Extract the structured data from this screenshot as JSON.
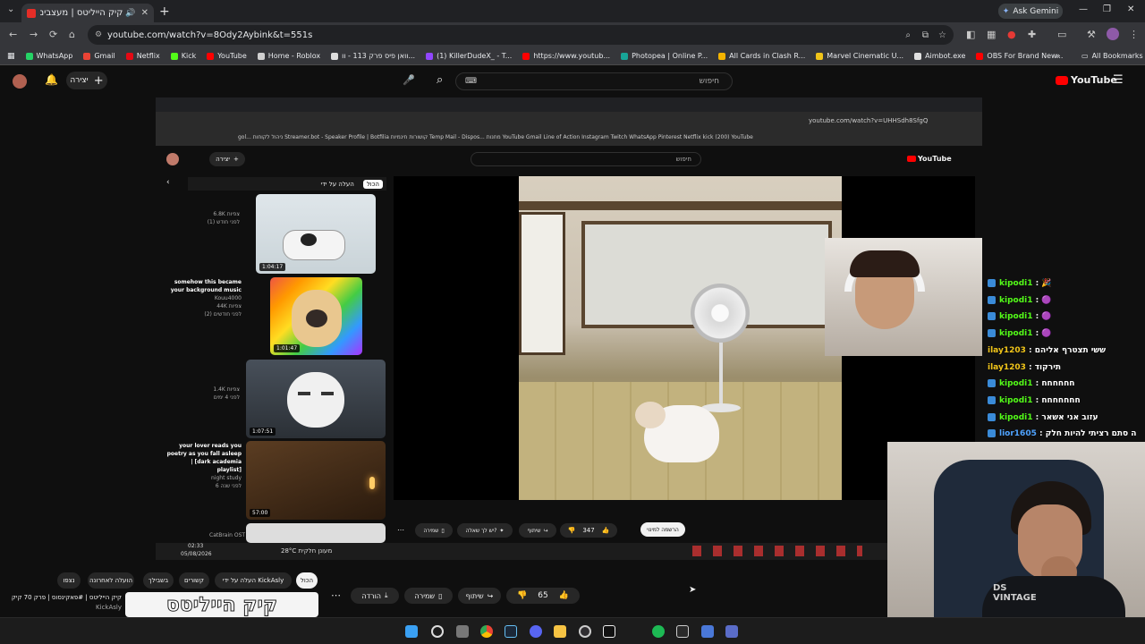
{
  "browser": {
    "tab_title": "קיק הייליטס | מעצבים איט",
    "omnibox_url": "youtube.com/watch?v=8Ody2Aybink&t=551s",
    "ask_gemini": "Ask Gemini",
    "all_bookmarks": "All Bookmarks",
    "bookmarks": [
      {
        "label": "WhatsApp",
        "color": "#25d366"
      },
      {
        "label": "Gmail",
        "color": "#ea4335"
      },
      {
        "label": "Netflix",
        "color": "#e50914"
      },
      {
        "label": "Kick",
        "color": "#53fc18"
      },
      {
        "label": "YouTube",
        "color": "#ff0000"
      },
      {
        "label": "Home - Roblox",
        "color": "#d0d0d0"
      },
      {
        "label": "וואן פיס פרק 113 - וו...",
        "color": "#dddddd"
      },
      {
        "label": "(1) KillerDudeX_ - T...",
        "color": "#9146ff"
      },
      {
        "label": "https://www.youtub...",
        "color": "#ff0000"
      },
      {
        "label": "Photopea | Online P...",
        "color": "#18a497"
      },
      {
        "label": "All Cards in Clash R...",
        "color": "#f4b400"
      },
      {
        "label": "Marvel Cinematic U...",
        "color": "#f0c419"
      },
      {
        "label": "Aimbot.exe",
        "color": "#e0e0e0"
      },
      {
        "label": "OBS For Brand New...",
        "color": "#ff0000"
      }
    ]
  },
  "yt": {
    "create_label": "יצירה",
    "search_placeholder": "חיפוש",
    "logo_text": "YouTube"
  },
  "nested": {
    "url": "youtube.com/watch?v=UHHSdh8SfgQ",
    "bookmarks_text": "gol...  ניהול לקוחות  Streamer.bot - Speaker  Profile | Botfilia  קושורות חינמיות  Temp Mail - Dispos...  מחנות  YouTube  Gmail  Line of Action  Instagram  Twitch  WhatsApp  Pinterest  Netflix  kick  (200) YouTube",
    "create_label": "יצירה",
    "search_placeholder": "חיפוש",
    "logo_text": "YouTube",
    "playlist_header": "העלה על ידי",
    "all_chip": "הכול",
    "playlist": [
      {
        "title": "",
        "meta1": "6.8K צפיות",
        "meta2": "(1) לפני חודש",
        "duration": "1:04:17"
      },
      {
        "title": "somehow this became your background music",
        "meta1": "Kouu4000",
        "meta2": "44K צפיות",
        "meta3": "(2) לפני חודשים",
        "duration": "1:01:47"
      },
      {
        "title": "",
        "meta1": "1.4K צפיות",
        "meta2": "לפני 4 ימים",
        "duration": "1:07:51"
      },
      {
        "title": "your lover reads you poetry as you fall asleep | [dark academia playlist]",
        "meta1": "night study",
        "meta2": "6 לפני שנה",
        "duration": "57:00"
      }
    ],
    "likes": "347",
    "share": "שיתוף",
    "ask": "יש לך שאלה?",
    "save": "שמירה",
    "subscribe_hint": "הרשמה למינוי",
    "taskbar_time": "02:33",
    "taskbar_date": "05/08/2026",
    "weather": "28°C מעונן חלקית",
    "catbrain": "CatBrain OST"
  },
  "chat": [
    {
      "user": "kipodi1",
      "text": "🎉",
      "color": "#53fc18",
      "badge": true
    },
    {
      "user": "kipodi1",
      "text": "🟣",
      "color": "#53fc18",
      "badge": true
    },
    {
      "user": "kipodi1",
      "text": "🟣",
      "color": "#53fc18",
      "badge": true
    },
    {
      "user": "kipodi1",
      "text": "🟣",
      "color": "#53fc18",
      "badge": true
    },
    {
      "user": "ilay1203",
      "text": "ששי תצטרף אליהם",
      "color": "#f0c419",
      "badge": false
    },
    {
      "user": "ilay1203",
      "text": "תירקוד",
      "color": "#f0c419",
      "badge": false
    },
    {
      "user": "kipodi1",
      "text": "חחחחחח",
      "color": "#53fc18",
      "badge": true
    },
    {
      "user": "kipodi1",
      "text": "חחחחחחח",
      "color": "#53fc18",
      "badge": true
    },
    {
      "user": "kipodi1",
      "text": "עזוב אני אשאר",
      "color": "#53fc18",
      "badge": true
    },
    {
      "user": "lior1605",
      "text": "ה סתם רציתי להיות חלק",
      "color": "#4fa3ff",
      "badge": true
    }
  ],
  "bottom": {
    "chips": [
      "הכול",
      "העלה על ידי KickAsly",
      "קשורים",
      "בשבילך",
      "הועלה לאחרונה",
      "נצפו"
    ],
    "video_title": "קיק הייליטס | #פאקינסוס | פרק 70 קיק",
    "channel": "KickAsly",
    "likes": "65",
    "share": "שיתוף",
    "save": "שמירה",
    "download": "הורדה",
    "banner_text": "קיק הייליטס"
  }
}
